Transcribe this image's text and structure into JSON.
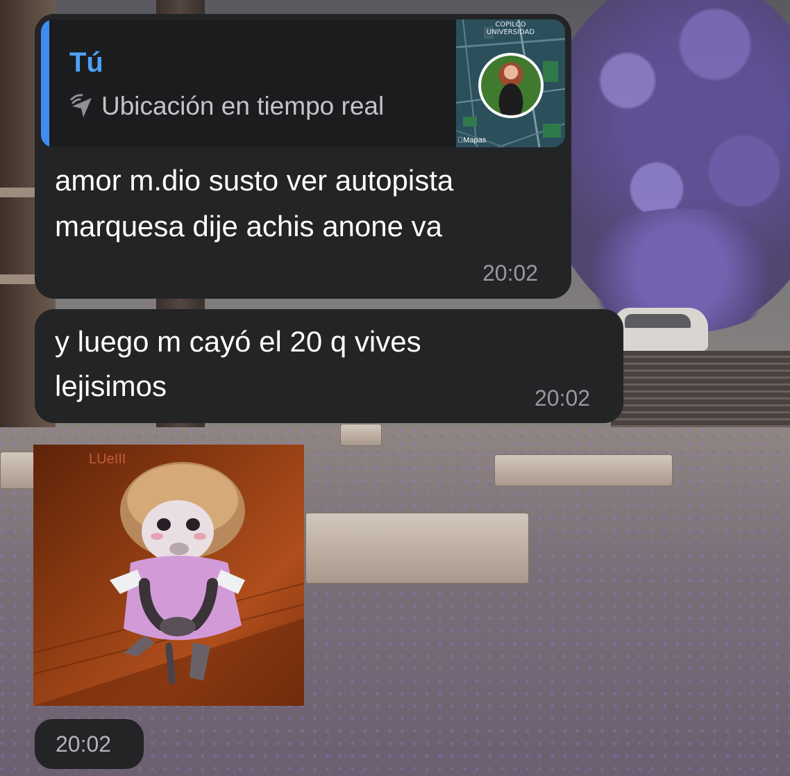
{
  "messages": [
    {
      "reply": {
        "author": "Tú",
        "icon": "live-location-icon",
        "label": "Ubicación en tiempo real",
        "map": {
          "district_line1": "COPILCO",
          "district_line2": "UNIVERSIDAD",
          "brand": "Mapas"
        }
      },
      "text_line1": "amor m.dio susto ver autopista",
      "text_line2": "marquesa dije achis anone va",
      "time": "20:02"
    },
    {
      "text_line1": "y luego m cayó el 20 q vives",
      "text_line2": "lejisimos",
      "time": "20:02"
    },
    {
      "sticker": "monkey-sticker",
      "watermark": "LUeIII",
      "time": "20:02"
    }
  ],
  "colors": {
    "bubble": "#232425",
    "reply_accent": "#3d8df5",
    "reply_author": "#4ea0f7",
    "time_text": "#98999c"
  }
}
